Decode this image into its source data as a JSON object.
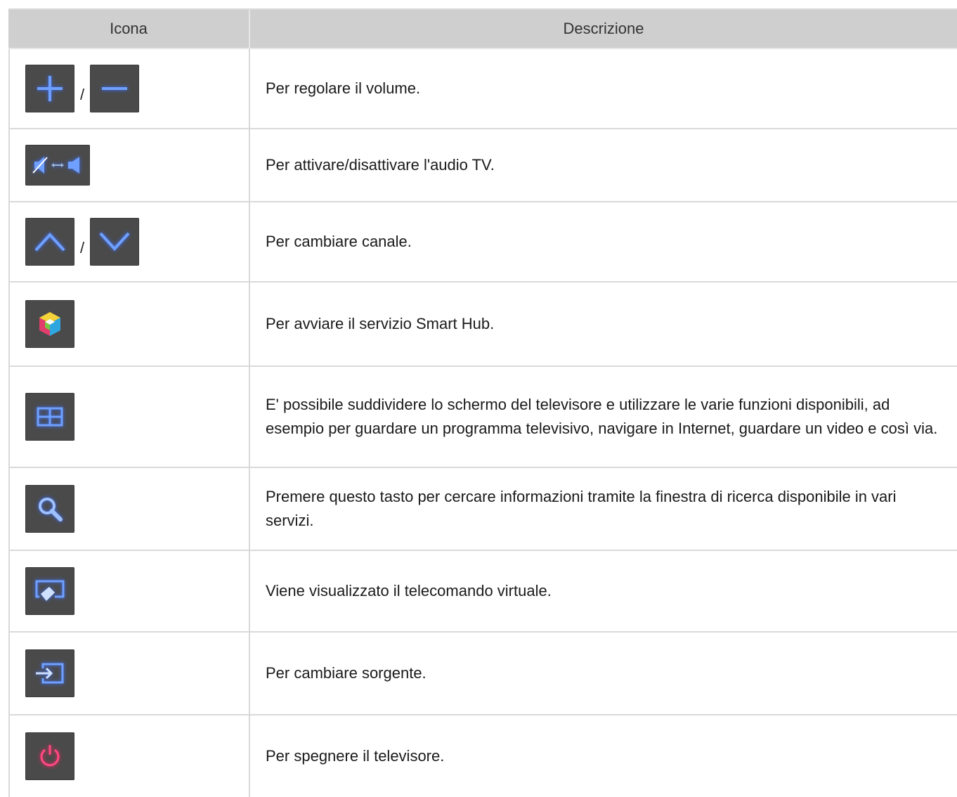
{
  "table": {
    "header": {
      "icon_col": "Icona",
      "desc_col": "Descrizione"
    },
    "rows": [
      {
        "icons": [
          "plus-icon",
          "minus-icon"
        ],
        "separator": "/",
        "description": "Per regolare il volume."
      },
      {
        "icons": [
          "mute-toggle-icon"
        ],
        "description": "Per attivare/disattivare l'audio TV."
      },
      {
        "icons": [
          "chevron-up-icon",
          "chevron-down-icon"
        ],
        "separator": "/",
        "description": "Per cambiare canale."
      },
      {
        "icons": [
          "smart-hub-icon"
        ],
        "description": "Per avviare il servizio Smart Hub."
      },
      {
        "icons": [
          "multi-screen-icon"
        ],
        "description": "E' possibile suddividere lo schermo del televisore e utilizzare le varie funzioni disponibili, ad esempio per guardare un programma televisivo, navigare in Internet, guardare un video e così via."
      },
      {
        "icons": [
          "search-icon"
        ],
        "description": "Premere questo tasto per cercare informazioni tramite la finestra di ricerca disponibile in vari servizi."
      },
      {
        "icons": [
          "virtual-remote-icon"
        ],
        "description": "Viene visualizzato il telecomando virtuale."
      },
      {
        "icons": [
          "source-icon"
        ],
        "description": "Per cambiare sorgente."
      },
      {
        "icons": [
          "power-icon"
        ],
        "description": "Per spegnere il televisore."
      }
    ]
  },
  "colors": {
    "button_bg": "#4a4a4a",
    "icon_blue": "#4f86ff",
    "icon_red": "#ff3d7a",
    "header_bg": "#cfcfcf",
    "grid_line": "#d9d9d9"
  }
}
